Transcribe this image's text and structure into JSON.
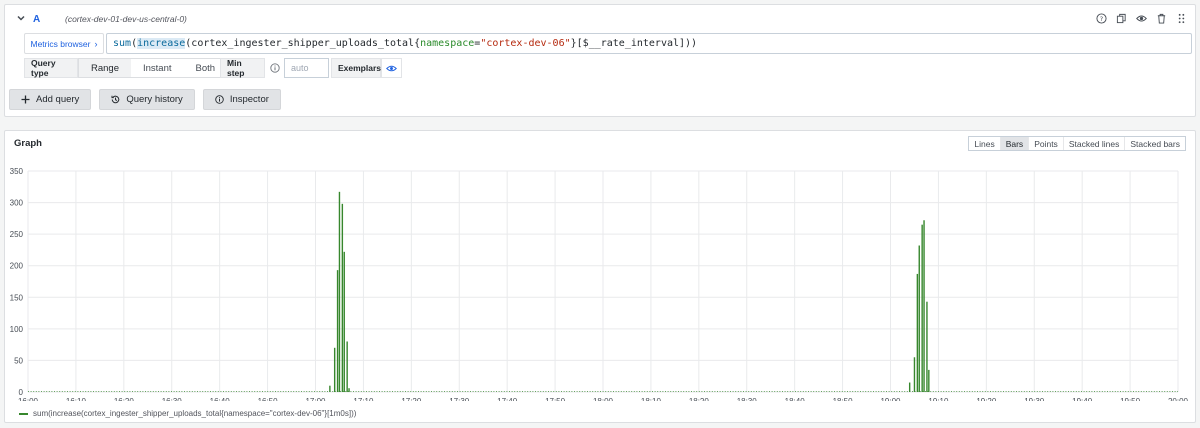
{
  "query": {
    "ref_id": "A",
    "datasource": "(cortex-dev-01-dev-us-central-0)",
    "metrics_browser_label": "Metrics browser",
    "expression_tokens": [
      {
        "t": "sum",
        "c": "tok-fn"
      },
      {
        "t": "(",
        "c": "tok-punct"
      },
      {
        "t": "increase",
        "c": "tok-fn-hl"
      },
      {
        "t": "(",
        "c": "tok-punct"
      },
      {
        "t": "cortex_ingester_shipper_uploads_total",
        "c": "tok-metric"
      },
      {
        "t": "{",
        "c": "tok-punct"
      },
      {
        "t": "namespace",
        "c": "tok-label"
      },
      {
        "t": "=",
        "c": "tok-punct"
      },
      {
        "t": "\"cortex-dev-06\"",
        "c": "tok-str"
      },
      {
        "t": "}",
        "c": "tok-punct"
      },
      {
        "t": "[$__rate_interval]))",
        "c": "tok-punct"
      }
    ],
    "query_type_label": "Query type",
    "query_types": [
      "Range",
      "Instant",
      "Both"
    ],
    "min_step_label": "Min step",
    "min_step_placeholder": "auto",
    "exemplars_label": "Exemplars",
    "buttons": {
      "add_query": "Add query",
      "query_history": "Query history",
      "inspector": "Inspector"
    }
  },
  "graph": {
    "title": "Graph",
    "vis_modes": [
      "Lines",
      "Bars",
      "Points",
      "Stacked lines",
      "Stacked bars"
    ],
    "active_mode": "Bars",
    "legend": "sum(increase(cortex_ingester_shipper_uploads_total{namespace=\"cortex-dev-06\"}[1m0s]))"
  },
  "colors": {
    "series": "#37872d",
    "accent": "#1f62e0"
  },
  "chart_data": {
    "type": "bar",
    "ylim": [
      0,
      350
    ],
    "y_ticks": [
      0,
      50,
      100,
      150,
      200,
      250,
      300,
      350
    ],
    "x_ticks": [
      "16:00",
      "16:10",
      "16:20",
      "16:30",
      "16:40",
      "16:50",
      "17:00",
      "17:10",
      "17:20",
      "17:30",
      "17:40",
      "17:50",
      "18:00",
      "18:10",
      "18:20",
      "18:30",
      "18:40",
      "18:50",
      "19:00",
      "19:10",
      "19:20",
      "19:30",
      "19:40",
      "19:50",
      "20:00"
    ],
    "grid": true,
    "series": [
      {
        "name": "sum(increase(cortex_ingester_shipper_uploads_total{namespace=\"cortex-dev-06\"}[1m0s]))",
        "points": [
          {
            "x": "17:03",
            "y": 10
          },
          {
            "x": "17:04",
            "y": 70
          },
          {
            "x": "17:04",
            "y": 193
          },
          {
            "x": "17:05",
            "y": 317
          },
          {
            "x": "17:05",
            "y": 298
          },
          {
            "x": "17:06",
            "y": 222
          },
          {
            "x": "17:06",
            "y": 80
          },
          {
            "x": "17:07",
            "y": 6
          },
          {
            "x": "19:04",
            "y": 15
          },
          {
            "x": "19:05",
            "y": 55
          },
          {
            "x": "19:05",
            "y": 187
          },
          {
            "x": "19:06",
            "y": 232
          },
          {
            "x": "19:06",
            "y": 265
          },
          {
            "x": "19:07",
            "y": 272
          },
          {
            "x": "19:07",
            "y": 143
          },
          {
            "x": "19:08",
            "y": 35
          }
        ]
      }
    ]
  }
}
